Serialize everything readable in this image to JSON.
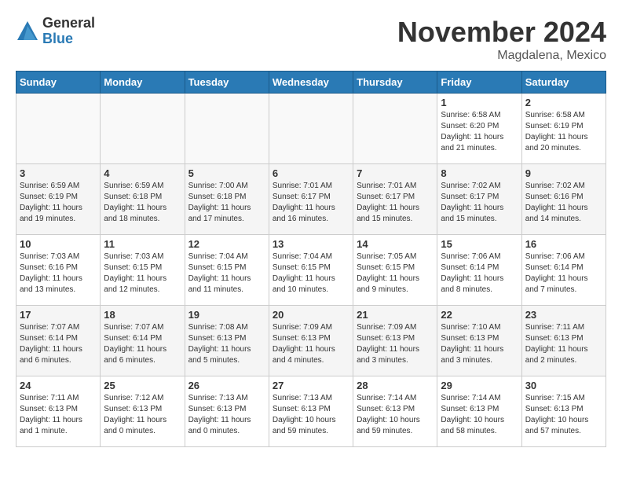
{
  "logo": {
    "general": "General",
    "blue": "Blue"
  },
  "header": {
    "month": "November 2024",
    "location": "Magdalena, Mexico"
  },
  "weekdays": [
    "Sunday",
    "Monday",
    "Tuesday",
    "Wednesday",
    "Thursday",
    "Friday",
    "Saturday"
  ],
  "weeks": [
    [
      {
        "day": "",
        "info": ""
      },
      {
        "day": "",
        "info": ""
      },
      {
        "day": "",
        "info": ""
      },
      {
        "day": "",
        "info": ""
      },
      {
        "day": "",
        "info": ""
      },
      {
        "day": "1",
        "info": "Sunrise: 6:58 AM\nSunset: 6:20 PM\nDaylight: 11 hours and 21 minutes."
      },
      {
        "day": "2",
        "info": "Sunrise: 6:58 AM\nSunset: 6:19 PM\nDaylight: 11 hours and 20 minutes."
      }
    ],
    [
      {
        "day": "3",
        "info": "Sunrise: 6:59 AM\nSunset: 6:19 PM\nDaylight: 11 hours and 19 minutes."
      },
      {
        "day": "4",
        "info": "Sunrise: 6:59 AM\nSunset: 6:18 PM\nDaylight: 11 hours and 18 minutes."
      },
      {
        "day": "5",
        "info": "Sunrise: 7:00 AM\nSunset: 6:18 PM\nDaylight: 11 hours and 17 minutes."
      },
      {
        "day": "6",
        "info": "Sunrise: 7:01 AM\nSunset: 6:17 PM\nDaylight: 11 hours and 16 minutes."
      },
      {
        "day": "7",
        "info": "Sunrise: 7:01 AM\nSunset: 6:17 PM\nDaylight: 11 hours and 15 minutes."
      },
      {
        "day": "8",
        "info": "Sunrise: 7:02 AM\nSunset: 6:17 PM\nDaylight: 11 hours and 15 minutes."
      },
      {
        "day": "9",
        "info": "Sunrise: 7:02 AM\nSunset: 6:16 PM\nDaylight: 11 hours and 14 minutes."
      }
    ],
    [
      {
        "day": "10",
        "info": "Sunrise: 7:03 AM\nSunset: 6:16 PM\nDaylight: 11 hours and 13 minutes."
      },
      {
        "day": "11",
        "info": "Sunrise: 7:03 AM\nSunset: 6:15 PM\nDaylight: 11 hours and 12 minutes."
      },
      {
        "day": "12",
        "info": "Sunrise: 7:04 AM\nSunset: 6:15 PM\nDaylight: 11 hours and 11 minutes."
      },
      {
        "day": "13",
        "info": "Sunrise: 7:04 AM\nSunset: 6:15 PM\nDaylight: 11 hours and 10 minutes."
      },
      {
        "day": "14",
        "info": "Sunrise: 7:05 AM\nSunset: 6:15 PM\nDaylight: 11 hours and 9 minutes."
      },
      {
        "day": "15",
        "info": "Sunrise: 7:06 AM\nSunset: 6:14 PM\nDaylight: 11 hours and 8 minutes."
      },
      {
        "day": "16",
        "info": "Sunrise: 7:06 AM\nSunset: 6:14 PM\nDaylight: 11 hours and 7 minutes."
      }
    ],
    [
      {
        "day": "17",
        "info": "Sunrise: 7:07 AM\nSunset: 6:14 PM\nDaylight: 11 hours and 6 minutes."
      },
      {
        "day": "18",
        "info": "Sunrise: 7:07 AM\nSunset: 6:14 PM\nDaylight: 11 hours and 6 minutes."
      },
      {
        "day": "19",
        "info": "Sunrise: 7:08 AM\nSunset: 6:13 PM\nDaylight: 11 hours and 5 minutes."
      },
      {
        "day": "20",
        "info": "Sunrise: 7:09 AM\nSunset: 6:13 PM\nDaylight: 11 hours and 4 minutes."
      },
      {
        "day": "21",
        "info": "Sunrise: 7:09 AM\nSunset: 6:13 PM\nDaylight: 11 hours and 3 minutes."
      },
      {
        "day": "22",
        "info": "Sunrise: 7:10 AM\nSunset: 6:13 PM\nDaylight: 11 hours and 3 minutes."
      },
      {
        "day": "23",
        "info": "Sunrise: 7:11 AM\nSunset: 6:13 PM\nDaylight: 11 hours and 2 minutes."
      }
    ],
    [
      {
        "day": "24",
        "info": "Sunrise: 7:11 AM\nSunset: 6:13 PM\nDaylight: 11 hours and 1 minute."
      },
      {
        "day": "25",
        "info": "Sunrise: 7:12 AM\nSunset: 6:13 PM\nDaylight: 11 hours and 0 minutes."
      },
      {
        "day": "26",
        "info": "Sunrise: 7:13 AM\nSunset: 6:13 PM\nDaylight: 11 hours and 0 minutes."
      },
      {
        "day": "27",
        "info": "Sunrise: 7:13 AM\nSunset: 6:13 PM\nDaylight: 10 hours and 59 minutes."
      },
      {
        "day": "28",
        "info": "Sunrise: 7:14 AM\nSunset: 6:13 PM\nDaylight: 10 hours and 59 minutes."
      },
      {
        "day": "29",
        "info": "Sunrise: 7:14 AM\nSunset: 6:13 PM\nDaylight: 10 hours and 58 minutes."
      },
      {
        "day": "30",
        "info": "Sunrise: 7:15 AM\nSunset: 6:13 PM\nDaylight: 10 hours and 57 minutes."
      }
    ]
  ]
}
